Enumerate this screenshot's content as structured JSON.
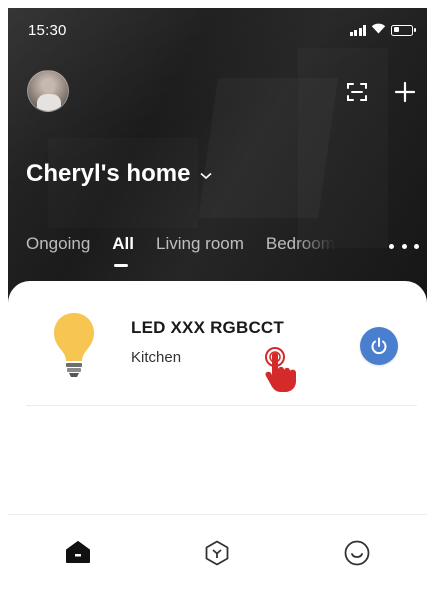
{
  "status_bar": {
    "time": "15:30"
  },
  "home": {
    "title": "Cheryl's home"
  },
  "tabs": [
    {
      "label": "Ongoing",
      "active": false
    },
    {
      "label": "All",
      "active": true
    },
    {
      "label": "Living room",
      "active": false
    },
    {
      "label": "Bedroom",
      "active": false
    }
  ],
  "device": {
    "name": "LED XXX RGBCCT",
    "room": "Kitchen",
    "icon": "light-bulb-icon",
    "power_color": "#4a7fd0",
    "bulb_color": "#f6c552"
  },
  "top_actions": [
    "scan-icon",
    "add-icon"
  ],
  "bottom_nav": [
    {
      "name": "home",
      "icon": "home-icon",
      "active": true
    },
    {
      "name": "scene",
      "icon": "scene-cube-icon",
      "active": false
    },
    {
      "name": "me",
      "icon": "profile-smile-icon",
      "active": false
    }
  ],
  "colors": {
    "header_bg": "#1f1f1f",
    "accent": "#4a7fd0",
    "pointer": "#d42a2a"
  }
}
